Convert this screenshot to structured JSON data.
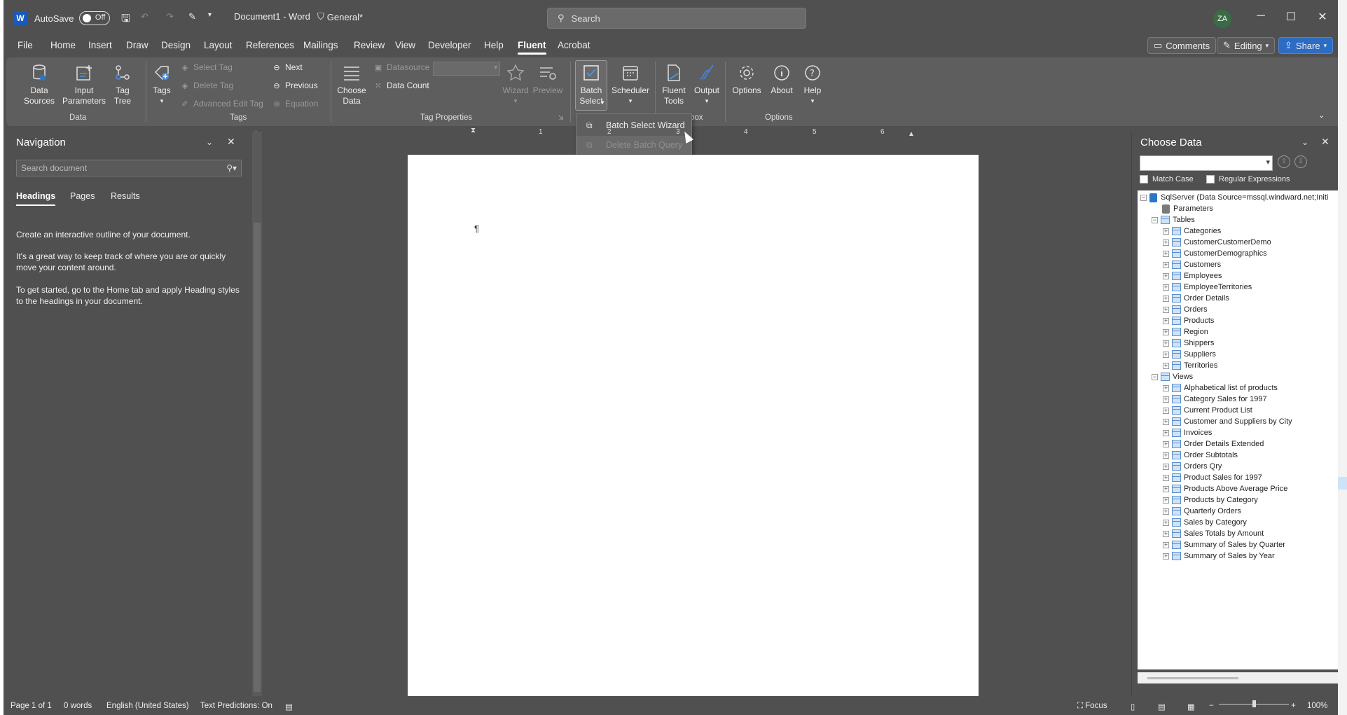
{
  "title_bar": {
    "autosave_label": "AutoSave",
    "autosave_state": "Off",
    "doc_title": "Document1 - Word",
    "sensitivity": "General*",
    "search_placeholder": "Search",
    "user_initials": "ZA",
    "minimize": "─",
    "maximize": "☐",
    "close": "✕"
  },
  "menu": {
    "tabs": [
      "File",
      "Home",
      "Insert",
      "Draw",
      "Design",
      "Layout",
      "References",
      "Mailings",
      "Review",
      "View",
      "Developer",
      "Help",
      "Fluent",
      "Acrobat"
    ],
    "active": "Fluent",
    "comments": "Comments",
    "editing": "Editing",
    "share": "Share"
  },
  "ribbon": {
    "data_sources": "Data\nSources",
    "input_parameters": "Input\nParameters",
    "tag_tree": "Tag\nTree",
    "group_data": "Data",
    "tags": "Tags",
    "select_tag": "Select Tag",
    "delete_tag": "Delete Tag",
    "advanced_edit_tag": "Advanced Edit Tag",
    "next": "Next",
    "previous": "Previous",
    "equation": "Equation",
    "group_tags": "Tags",
    "choose_data": "Choose\nData",
    "datasource": "Datasource",
    "data_count": "Data Count",
    "wizard": "Wizard",
    "preview": "Preview",
    "group_tag_properties": "Tag Properties",
    "batch_select": "Batch\nSelect",
    "scheduler": "Scheduler",
    "fluent_tools": "Fluent\nTools",
    "output": "Output",
    "group_toolbox_partial": "box",
    "options": "Options",
    "about": "About",
    "help": "Help",
    "group_options": "Options"
  },
  "dropdown": {
    "batch_select_wizard": "Batch Select Wizard",
    "delete_batch_query": "Delete Batch Query"
  },
  "navigation": {
    "title": "Navigation",
    "search_placeholder": "Search document",
    "tabs": [
      "Headings",
      "Pages",
      "Results"
    ],
    "text1": "Create an interactive outline of your document.",
    "text2": "It's a great way to keep track of where you are or quickly move your content around.",
    "text3": "To get started, go to the Home tab and apply Heading styles to the headings in your document."
  },
  "ruler": {
    "numbers": [
      "1",
      "2",
      "3",
      "4",
      "5",
      "6"
    ]
  },
  "document": {
    "pilcrow": "¶"
  },
  "choose_data": {
    "title": "Choose Data",
    "match_case": "Match Case",
    "regex": "Regular Expressions",
    "root": "SqlServer (Data Source=mssql.windward.net;Initi",
    "parameters": "Parameters",
    "tables_label": "Tables",
    "tables": [
      "Categories",
      "CustomerCustomerDemo",
      "CustomerDemographics",
      "Customers",
      "Employees",
      "EmployeeTerritories",
      "Order Details",
      "Orders",
      "Products",
      "Region",
      "Shippers",
      "Suppliers",
      "Territories"
    ],
    "views_label": "Views",
    "views": [
      "Alphabetical list of products",
      "Category Sales for 1997",
      "Current Product List",
      "Customer and Suppliers by City",
      "Invoices",
      "Order Details Extended",
      "Order Subtotals",
      "Orders Qry",
      "Product Sales for 1997",
      "Products Above Average Price",
      "Products by Category",
      "Quarterly Orders",
      "Sales by Category",
      "Sales Totals by Amount",
      "Summary of Sales by Quarter",
      "Summary of Sales by Year"
    ]
  },
  "status": {
    "page": "Page 1 of 1",
    "words": "0 words",
    "language": "English (United States)",
    "predictions": "Text Predictions: On",
    "focus": "Focus",
    "zoom": "100%"
  },
  "colors": {
    "chrome": "#505050",
    "ribbon": "#5e5e5e",
    "accent_share": "#2d6cc4"
  }
}
